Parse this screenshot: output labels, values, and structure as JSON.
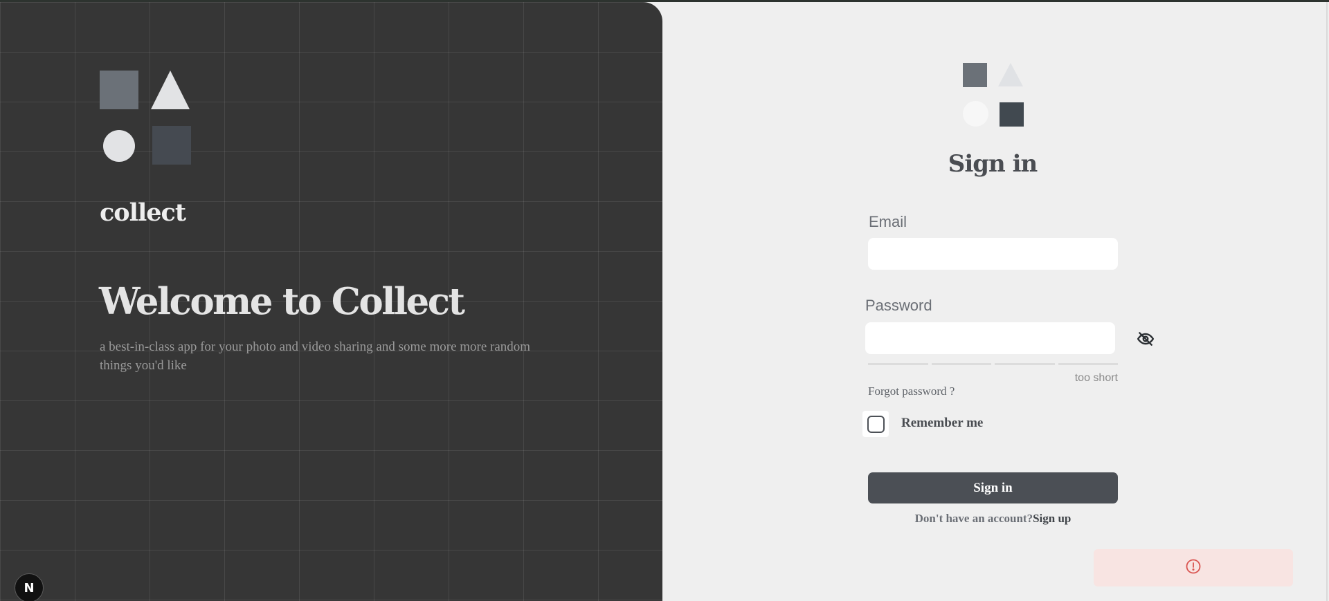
{
  "left_panel": {
    "brand": "collect",
    "welcome_title": "Welcome to Collect",
    "welcome_subtitle": "a best-in-class app for your photo and video sharing and some more more random things you'd like",
    "framework_badge": "N"
  },
  "form": {
    "title": "Sign in",
    "email_label": "Email",
    "email_value": "",
    "password_label": "Password",
    "password_value": "",
    "password_strength_text": "too short",
    "password_strength_level": 0,
    "forgot_password": "Forgot password ?",
    "remember_me_label": "Remember me",
    "remember_me_checked": false,
    "submit_label": "Sign in",
    "signup_prompt": "Don't have an account?",
    "signup_link": "Sign up"
  },
  "icons": {
    "password_toggle": "eye-off-icon",
    "alert": "alert-circle-icon",
    "badge": "nextjs-logo-icon"
  },
  "colors": {
    "left_panel_bg": "#363636",
    "page_bg": "#efefef",
    "button_bg": "#4b4f55",
    "alert_bg": "#f8e4e2",
    "alert_icon": "#d9534f"
  }
}
